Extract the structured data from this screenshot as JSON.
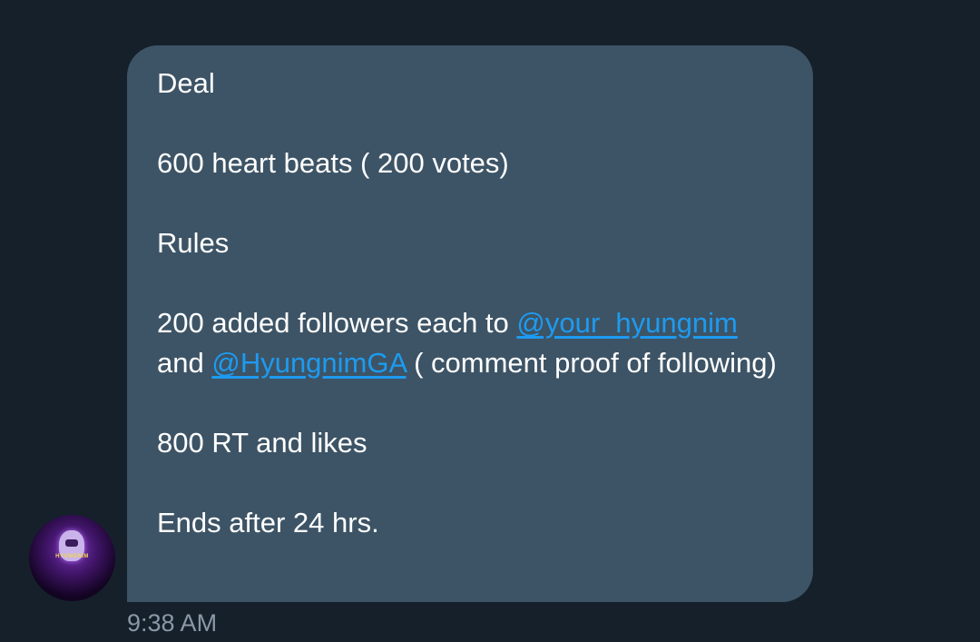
{
  "message": {
    "line_1": "Deal",
    "line_2": "600 heart beats ( 200 votes)",
    "line_3": "Rules",
    "line_4_prefix": "200 added followers each to ",
    "mention_1": "@your_hyungnim",
    "line_4_middle": "and ",
    "mention_2": "@HyungnimGA",
    "line_4_suffix": " ( comment proof of following)",
    "line_5": "800 RT and likes",
    "line_6": "Ends after 24 hrs."
  },
  "timestamp": "9:38 AM",
  "avatar": {
    "banner_text": "HYUNGNIM"
  },
  "icons": {
    "top_chevron": "chevron-down-icon"
  },
  "colors": {
    "background": "#15202b",
    "bubble": "#3d5466",
    "mention": "#1d9bf0",
    "timestamp": "#8b98a5"
  }
}
